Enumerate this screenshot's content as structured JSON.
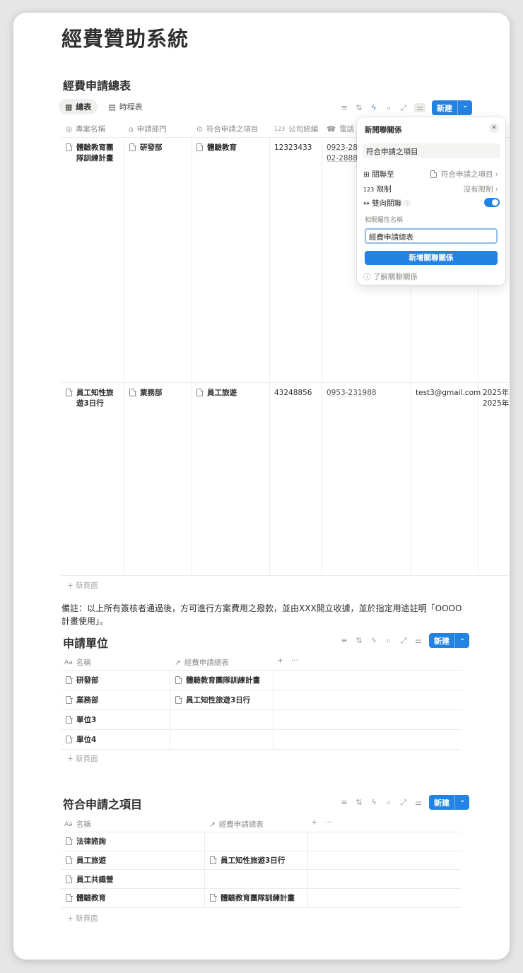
{
  "page": {
    "title": "經費贊助系統"
  },
  "db1": {
    "title": "經費申請總表",
    "tabs": [
      {
        "label": "總表",
        "icon": "table-icon"
      },
      {
        "label": "時程表",
        "icon": "calendar-icon"
      }
    ],
    "new_label": "新建",
    "columns": [
      "專案名稱",
      "申請部門",
      "符合申請之項目",
      "公司統編",
      "電話"
    ],
    "rows": [
      {
        "name_l1": "體驗教育團",
        "name_l2": "隊訓練計畫",
        "dept": "研發部",
        "item": "體驗教育",
        "tax": "12323433",
        "phone_l1": "0923-28",
        "phone_l2": "02-2888",
        "email": "",
        "extra_l1": "",
        "extra_l2": ""
      },
      {
        "name_l1": "員工知性旅",
        "name_l2": "遊3日行",
        "dept": "業務部",
        "item": "員工旅遊",
        "tax": "43248856",
        "phone_l1": "0953-231988",
        "phone_l2": "",
        "email": "test3@gmail.com",
        "extra_l1": "2025年",
        "extra_l2": "2025年"
      }
    ],
    "add_row": "+ 新頁面"
  },
  "popup": {
    "title": "新開聯關係",
    "search_value": "符合申請之項目",
    "relate_label": "關聯至",
    "relate_value": "符合申請之項目",
    "limit_label": "限制",
    "limit_value": "沒有限制",
    "two_way_label": "雙向關聯",
    "related_prop_label": "相關屬性名稱",
    "related_prop_value": "經費申請總表",
    "add_button": "新增關聯關係",
    "learn_link": "了解關聯關係"
  },
  "note": "備註：以上所有簽核者通過後，方可進行方案費用之撥款，並由XXX開立收據，並於指定用途註明「OOOO計畫使用」。",
  "db2": {
    "title": "申請單位",
    "new_label": "新建",
    "columns": [
      "名稱",
      "經費申請總表"
    ],
    "rows": [
      {
        "name": "研發部",
        "rel": "體驗教育團隊訓練計畫"
      },
      {
        "name": "業務部",
        "rel": "員工知性旅遊3日行"
      },
      {
        "name": "單位3",
        "rel": ""
      },
      {
        "name": "單位4",
        "rel": ""
      }
    ],
    "add_row": "+ 新頁面"
  },
  "db3": {
    "title": "符合申請之項目",
    "new_label": "新建",
    "columns": [
      "名稱",
      "經費申請總表"
    ],
    "rows": [
      {
        "name": "法律諮詢",
        "rel": ""
      },
      {
        "name": "員工旅遊",
        "rel": "員工知性旅遊3日行"
      },
      {
        "name": "員工共識營",
        "rel": ""
      },
      {
        "name": "體驗教育",
        "rel": "體驗教育團隊訓練計畫"
      }
    ],
    "add_row": "+ 新頁面"
  },
  "colors": {
    "accent": "#2383e2",
    "text": "#37352f",
    "muted": "#8c8b87",
    "border": "#ebebe9"
  }
}
